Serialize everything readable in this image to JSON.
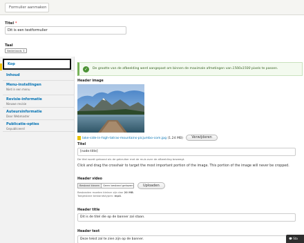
{
  "header": {
    "tab_label": "Formulier aanmaken"
  },
  "form": {
    "title_label": "Titel",
    "required_mark": "*",
    "title_value": "Dit is een testformulier",
    "language_label": "Taal",
    "language_value": "Nederlands"
  },
  "vertical_tabs": [
    {
      "title": "Kop",
      "summary": ""
    },
    {
      "title": "Inhoud",
      "summary": ""
    },
    {
      "title": "Menu-instellingen",
      "summary": "Niet in een menu"
    },
    {
      "title": "Revisie-informatie",
      "summary": "Nieuwe revisie"
    },
    {
      "title": "Auteursinformatie",
      "summary": "Door Webmaster"
    },
    {
      "title": "Publicatie-opties",
      "summary": "Gepubliceerd"
    }
  ],
  "message": {
    "icon": "check-icon",
    "text_before": "De grootte van de afbeelding werd aangepast om binnen de maximale afmetingen van ",
    "dimensions": "1500x1500",
    "text_after": " pixels te passen."
  },
  "header_image": {
    "label": "Header image",
    "file_icon": "image-file-icon",
    "file_name": "lake-side-in-high-tatras-mountains-picjumbo-com.jpg",
    "file_size": "(1.24 MB)",
    "remove_button": "Verwijderen",
    "title_label": "Titel",
    "title_value": "[node:title]",
    "title_help": "De titel wordt getoond als de gebruiker met de muis over de afbeelding beweegt.",
    "crosshair_help": "Click and drag the crosshair to target the most important portion of the image. This portion of the image will never be cropped."
  },
  "header_video": {
    "label": "Header video",
    "choose_button": "Bestand kiezen",
    "no_file": "Geen bestand gekozen",
    "upload_button": "Uploaden",
    "help_line1_prefix": "Bestanden moeten kleiner zijn dan ",
    "help_line1_size": "20 MB",
    "help_line2_prefix": "Toegestane bestandstypen: ",
    "help_line2_types": "mp4"
  },
  "header_title": {
    "label": "Header title",
    "value": "Dit is de titel die op de banner zal staan."
  },
  "header_text": {
    "label": "Header text",
    "value": "Deze tekst zal te zien zijn op de banner."
  },
  "chat_widget": {
    "label": "Sta"
  },
  "colors": {
    "link": "#0071b3",
    "status_ok": "#4b9234",
    "required": "#e00000",
    "accent": "#f0c000"
  }
}
